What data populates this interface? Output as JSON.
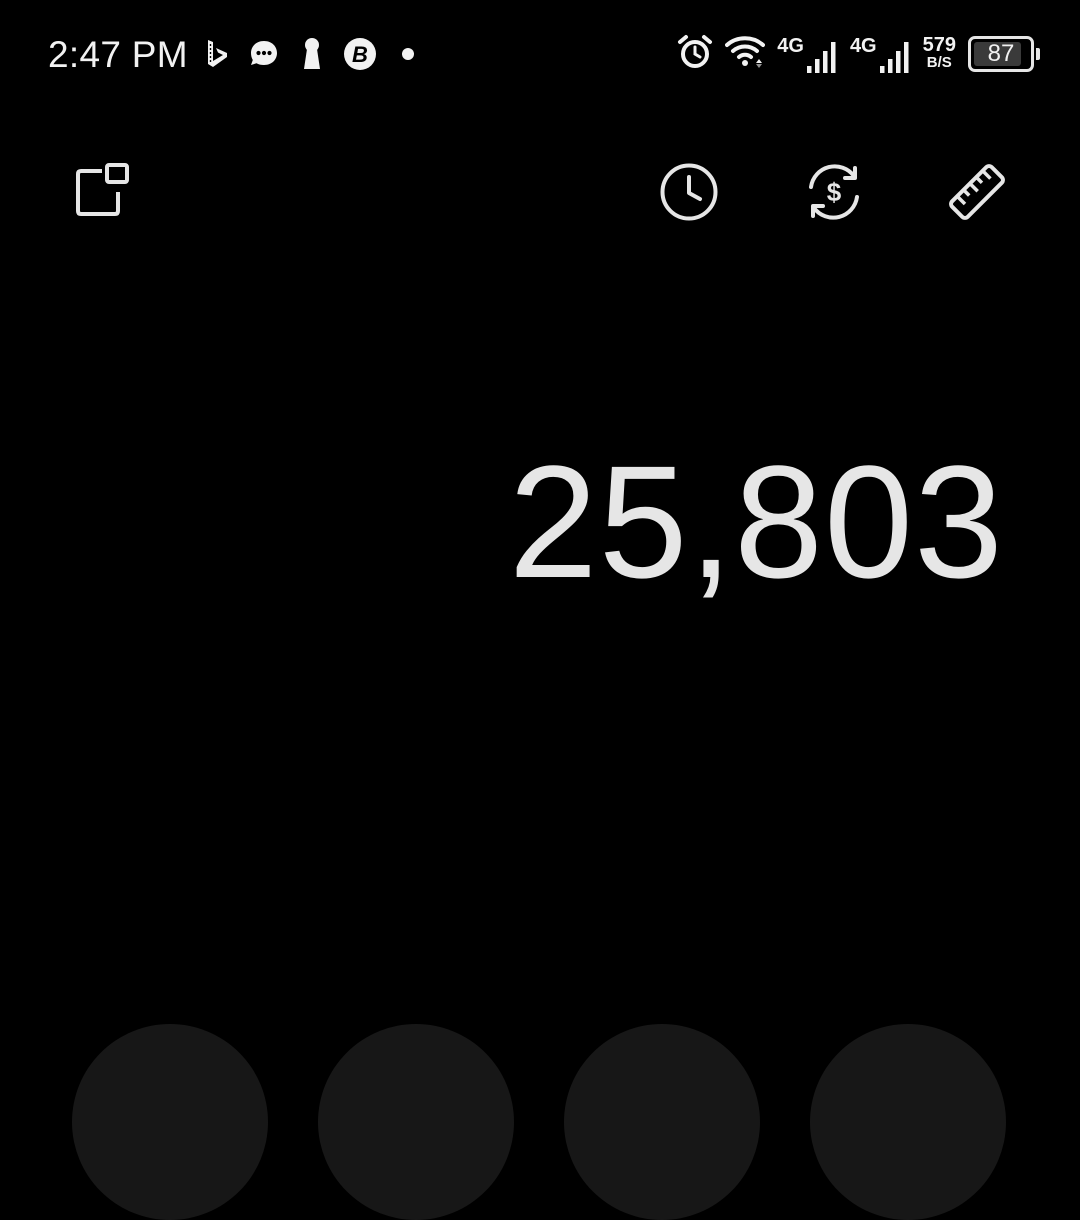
{
  "status_bar": {
    "time": "2:47 PM",
    "notification_icons": [
      "bing-icon",
      "chat-bubble-icon",
      "keyhole-icon",
      "b-circle-icon",
      "dot-icon"
    ],
    "network_1_label": "4G",
    "network_2_label": "4G",
    "speed_value": "579",
    "speed_unit": "B/S",
    "battery_percent": "87",
    "battery_level": 0.87
  },
  "toolbar": {
    "left_icon": "floating-window-icon",
    "right_icons": [
      "history-icon",
      "currency-converter-icon",
      "unit-converter-icon"
    ]
  },
  "display": {
    "value": "25,803"
  },
  "colors": {
    "background": "#000000",
    "text": "#e6e6e6",
    "key_background": "#171717"
  }
}
